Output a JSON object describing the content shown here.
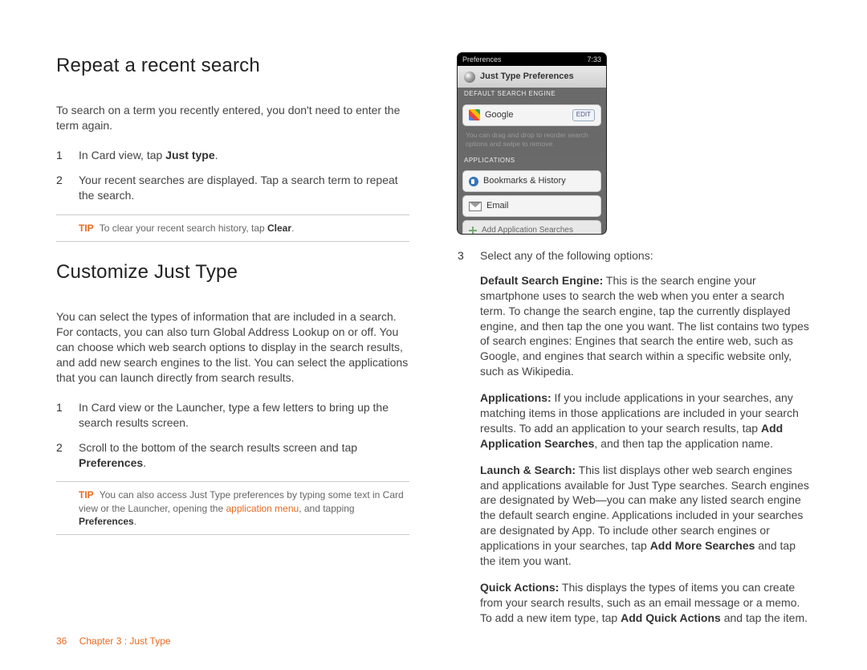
{
  "section1": {
    "title": "Repeat a recent search",
    "intro": "To search on a term you recently entered, you don't need to enter the term again.",
    "steps": [
      {
        "n": "1",
        "pre": "In Card view, tap ",
        "bold": "Just type",
        "post": "."
      },
      {
        "n": "2",
        "text": "Your recent searches are displayed. Tap a search term to repeat the search."
      }
    ],
    "tip": {
      "label": "TIP",
      "pre": "To clear your recent search history, tap ",
      "bold": "Clear",
      "post": "."
    }
  },
  "section2": {
    "title": "Customize Just Type",
    "intro": "You can select the types of information that are included in a search. For contacts, you can also turn Global Address Lookup on or off. You can choose which web search options to display in the search results, and add new search engines to the list. You can select the applications that you can launch directly from search results.",
    "steps": [
      {
        "n": "1",
        "text": "In Card view or the Launcher, type a few letters to bring up the search results screen."
      },
      {
        "n": "2",
        "pre": "Scroll to the bottom of the search results screen and tap ",
        "bold": "Preferences",
        "post": "."
      }
    ],
    "tip": {
      "label": "TIP",
      "pre": "You can also access Just Type preferences by typing some text in Card view or the Launcher, opening the ",
      "link": "application menu",
      "mid": ", and tapping ",
      "bold": "Preferences",
      "post": "."
    }
  },
  "screenshot": {
    "status_left": "Preferences",
    "status_time": "7:33",
    "title": "Just Type Preferences",
    "default_label": "DEFAULT SEARCH ENGINE",
    "google": "Google",
    "edit": "EDIT",
    "hint": "You can drag and drop to reorder search options and swipe to remove.",
    "apps_label": "APPLICATIONS",
    "row_bm": "Bookmarks & History",
    "row_email": "Email",
    "row_add": "Add Application Searches"
  },
  "right": {
    "step3": {
      "n": "3",
      "text": "Select any of the following options:"
    },
    "opts": [
      {
        "lead": "Default Search Engine:",
        "text": " This is the search engine your smartphone uses to search the web when you enter a search term. To change the search engine, tap the currently displayed engine, and then tap the one you want. The list contains two types of search engines: Engines that search the entire web, such as Google, and engines that search within a specific website only, such as Wikipedia."
      },
      {
        "lead": "Applications:",
        "pre": " If you include applications in your searches, any matching items in those applications are included in your search results. To add an application to your search results, tap ",
        "bold": "Add Application Searches",
        "post": ", and then tap the application name."
      },
      {
        "lead": "Launch & Search:",
        "pre": " This list displays other web search engines and applications available for Just Type searches. Search engines are designated by Web—you can make any listed search engine the default search engine. Applications included in your searches are designated by App. To include other search engines or applications in your searches, tap ",
        "bold": "Add More Searches",
        "post": " and tap the item you want."
      },
      {
        "lead": "Quick Actions:",
        "pre": " This displays the types of items you can create from your search results, such as an email message or a memo. To add a new item type, tap ",
        "bold": "Add Quick Actions",
        "post": " and tap the item."
      }
    ]
  },
  "footer": {
    "page": "36",
    "chapter": "Chapter 3 : Just Type"
  }
}
